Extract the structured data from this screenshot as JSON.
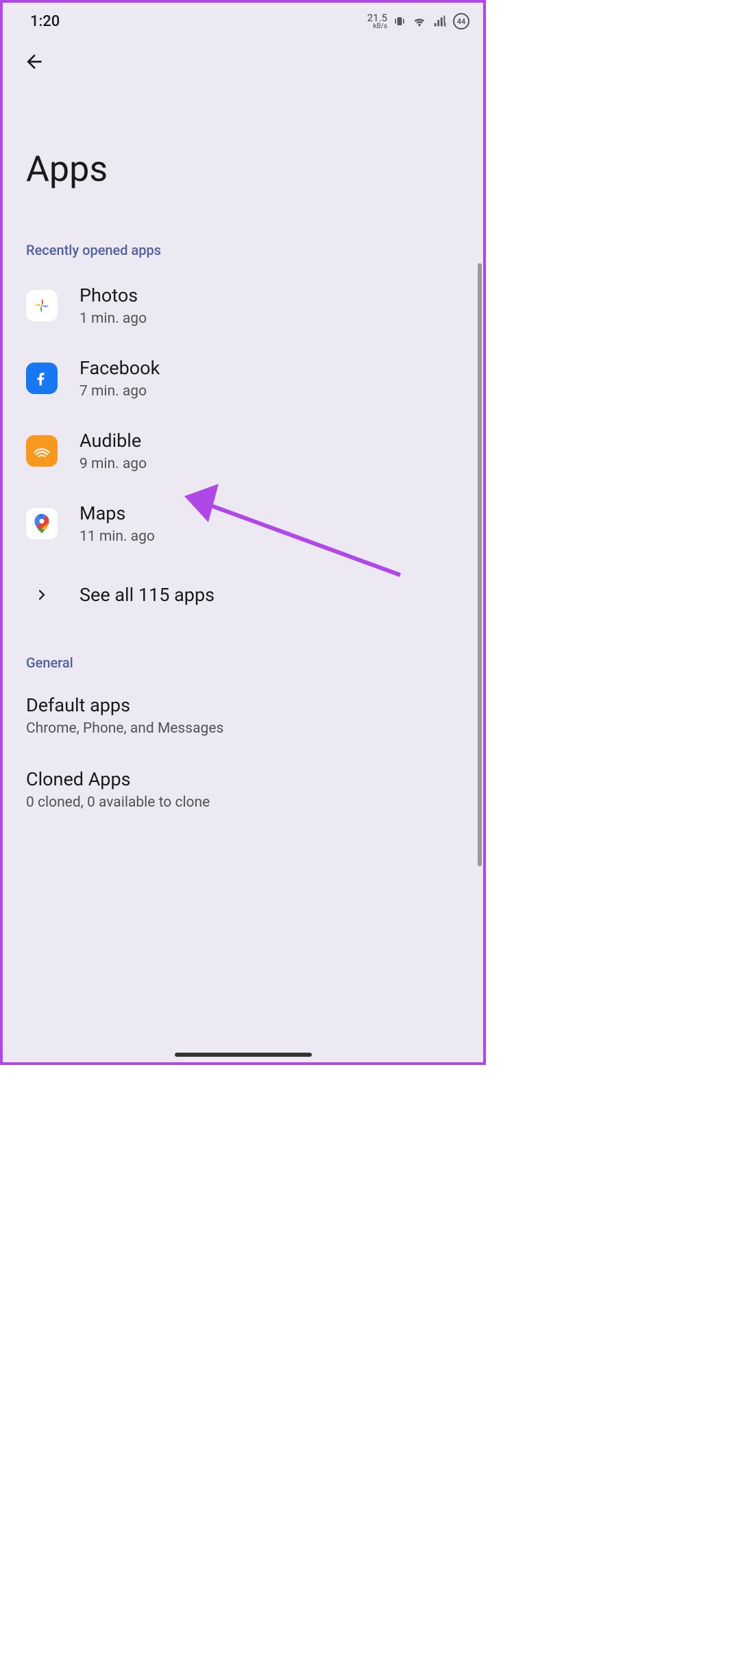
{
  "status": {
    "time": "1:20",
    "speed_value": "21.5",
    "speed_unit": "kB/s",
    "battery": "44"
  },
  "page": {
    "title": "Apps"
  },
  "recent": {
    "header": "Recently opened apps",
    "items": [
      {
        "name": "Photos",
        "sub": "1 min. ago"
      },
      {
        "name": "Facebook",
        "sub": "7 min. ago"
      },
      {
        "name": "Audible",
        "sub": "9 min. ago"
      },
      {
        "name": "Maps",
        "sub": "11 min. ago"
      }
    ],
    "see_all": "See all 115 apps"
  },
  "general": {
    "header": "General",
    "items": [
      {
        "title": "Default apps",
        "sub": "Chrome, Phone, and Messages"
      },
      {
        "title": "Cloned Apps",
        "sub": "0 cloned, 0 available to clone"
      }
    ]
  }
}
